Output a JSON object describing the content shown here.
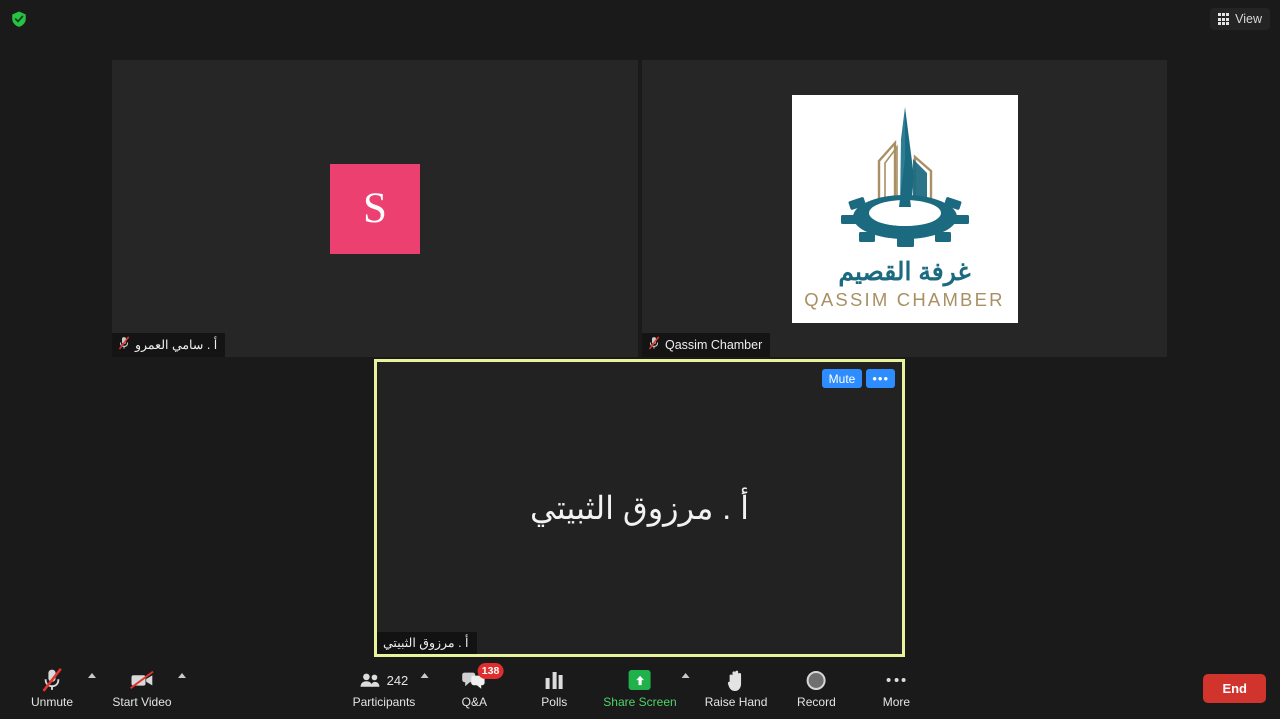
{
  "app": {
    "name": "Zoom Meeting",
    "background_color": "#1a1a1a"
  },
  "topbar": {
    "security_icon": "shield-check-icon",
    "security_color": "#25c243",
    "view_label": "View",
    "view_icon": "grid-icon"
  },
  "tiles": [
    {
      "id": "tile-1",
      "type": "avatar",
      "avatar_letter": "S",
      "avatar_color": "#ec4071",
      "name": "أ . سامي العمرو",
      "mic_status": "muted",
      "mic_icon": "mic-muted-icon"
    },
    {
      "id": "tile-2",
      "type": "logo",
      "name": "Qassim Chamber",
      "mic_status": "muted",
      "mic_icon": "mic-muted-icon",
      "logo": {
        "arabic": "غرفة القصيم",
        "english": "QASSIM CHAMBER",
        "teal": "#1c6a80",
        "gold": "#a99064"
      }
    },
    {
      "id": "tile-3",
      "type": "speaker",
      "name": "أ . مرزوق الثبيتي",
      "display_name": "أ . مرزوق الثبيتي",
      "active_speaker": true,
      "border_color": "#e9f39c",
      "actions": {
        "mute_label": "Mute",
        "more_label": "•••"
      }
    }
  ],
  "toolbar": {
    "left": [
      {
        "label": "Unmute",
        "icon": "mic-muted-icon",
        "chevron": true
      },
      {
        "label": "Start Video",
        "icon": "video-off-icon",
        "chevron": true
      }
    ],
    "center": [
      {
        "label": "Participants",
        "icon": "participants-icon",
        "count": "242",
        "chevron": true
      },
      {
        "label": "Q&A",
        "icon": "qa-bubbles-icon",
        "badge": "138"
      },
      {
        "label": "Polls",
        "icon": "polls-bar-icon"
      },
      {
        "label": "Share Screen",
        "icon": "share-screen-icon",
        "chevron": true,
        "highlight_color": "#4fd36a"
      },
      {
        "label": "Raise Hand",
        "icon": "hand-icon"
      },
      {
        "label": "Record",
        "icon": "record-circle-icon"
      },
      {
        "label": "More",
        "icon": "more-dots-icon"
      }
    ],
    "end_button": {
      "label": "End",
      "color": "#d0342c"
    }
  }
}
